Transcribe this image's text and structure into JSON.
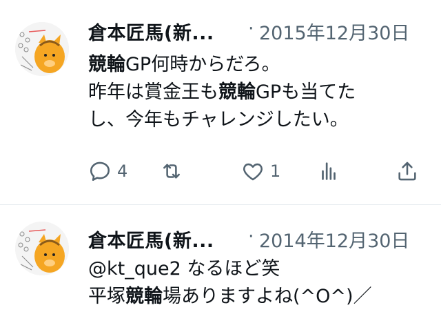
{
  "tweets": [
    {
      "author_name": "倉本匠馬(新...",
      "separator": "·",
      "date": "2015年12月30日",
      "text_lines": [
        [
          "競輪",
          "GP何時からだろ。"
        ],
        [
          "昨年は賞金王も",
          "競輪",
          "GPも当てたし、今年もチャレンジしたい。"
        ]
      ],
      "line1_bold": "競輪",
      "line1_rest": "GP何時からだろ。",
      "line2_pre": "昨年は賞金王も",
      "line2_bold": "競輪",
      "line2_post": "GPも当てた",
      "line3": "し、今年もチャレンジしたい。",
      "actions": {
        "reply_count": "4",
        "retweet_count": "",
        "like_count": "1"
      }
    },
    {
      "author_name": "倉本匠馬(新...",
      "separator": "·",
      "date": "2014年12月30日",
      "line1": "@kt_que2 なるほど笑",
      "line2_pre": "平塚",
      "line2_bold": "競輪",
      "line2_post": "場ありますよね(^O^)／"
    }
  ],
  "icons": {
    "reply": "reply-icon",
    "retweet": "retweet-icon",
    "like": "heart-icon",
    "stats": "stats-icon",
    "share": "share-icon"
  },
  "colors": {
    "text": "#0f1419",
    "secondary": "#536471",
    "divider": "#e6ecf0",
    "avatar_orange": "#f5a623"
  }
}
